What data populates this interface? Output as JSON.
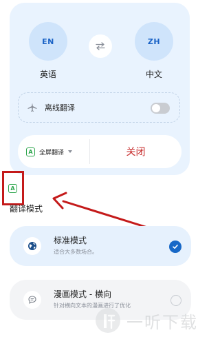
{
  "languages": {
    "source": {
      "code": "EN",
      "name": "英语"
    },
    "target": {
      "code": "ZH",
      "name": "中文"
    }
  },
  "offline": {
    "label": "离线翻译",
    "enabled": false
  },
  "actions": {
    "fullscreen_label": "全屏翻译",
    "badge_letter": "A",
    "close_label": "关闭"
  },
  "annotation": {
    "badge_letter": "A"
  },
  "section": {
    "title": "翻译模式"
  },
  "modes": [
    {
      "title": "标准模式",
      "subtitle": "适合大多数场合。",
      "selected": true
    },
    {
      "title": "漫画模式 - 横向",
      "subtitle": "针对横向文本的漫画进行了优化",
      "selected": false
    }
  ],
  "watermark": {
    "text": "一听下载"
  },
  "colors": {
    "accent": "#1768c7",
    "close": "#c62828",
    "annotation": "#c41a1a",
    "badge": "#2aa44a"
  }
}
